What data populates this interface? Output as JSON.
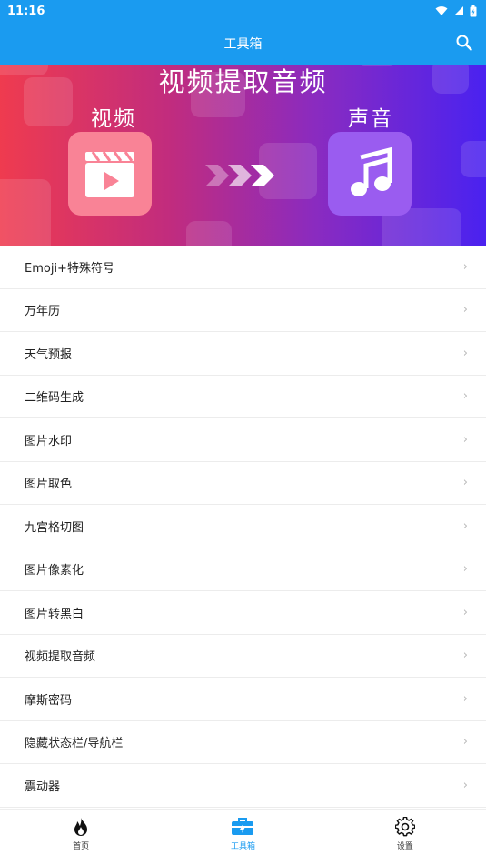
{
  "status": {
    "time": "11:16"
  },
  "appbar": {
    "title": "工具箱"
  },
  "banner": {
    "headline": "视频提取音频",
    "left_label": "视频",
    "right_label": "声音"
  },
  "tools": [
    {
      "label": "Emoji+特殊符号"
    },
    {
      "label": "万年历"
    },
    {
      "label": "天气预报"
    },
    {
      "label": "二维码生成"
    },
    {
      "label": "图片水印"
    },
    {
      "label": "图片取色"
    },
    {
      "label": "九宫格切图"
    },
    {
      "label": "图片像素化"
    },
    {
      "label": "图片转黑白"
    },
    {
      "label": "视频提取音频"
    },
    {
      "label": "摩斯密码"
    },
    {
      "label": "隐藏状态栏/导航栏"
    },
    {
      "label": "震动器"
    }
  ],
  "chevron": "›",
  "tabs": [
    {
      "label": "首页",
      "icon": "flame-icon"
    },
    {
      "label": "工具箱",
      "icon": "toolbox-icon"
    },
    {
      "label": "设置",
      "icon": "gear-icon"
    }
  ],
  "colors": {
    "primary": "#1a9bf0"
  }
}
